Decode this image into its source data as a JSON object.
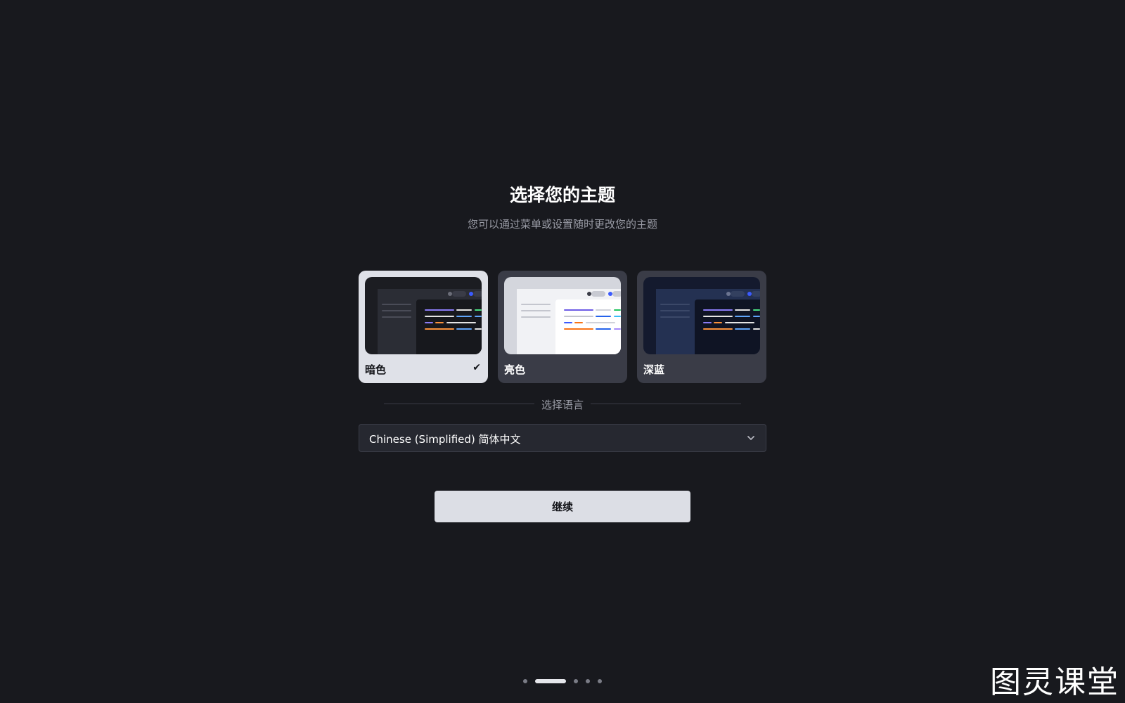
{
  "header": {
    "title": "选择您的主题",
    "subtitle": "您可以通过菜单或设置随时更改您的主题"
  },
  "themes": [
    {
      "label": "暗色",
      "selected": true,
      "check_icon": "check-icon",
      "check_glyph": "✔"
    },
    {
      "label": "亮色",
      "selected": false
    },
    {
      "label": "深蓝",
      "selected": false
    }
  ],
  "language": {
    "section_label": "选择语言",
    "selected_value": "Chinese (Simplified) 简体中文",
    "icon": "chevron-down-icon"
  },
  "actions": {
    "continue_label": "继续"
  },
  "pagination": {
    "total_steps": 5,
    "current_step": 2
  },
  "watermark": {
    "text": "图灵课堂"
  },
  "colors": {
    "background": "#18191e",
    "card": "#3a3c47",
    "card_selected": "#dfe1e8",
    "button": "#dcdee5",
    "muted_text": "#9a9ca6",
    "accent_blue": "#3b5bff"
  }
}
